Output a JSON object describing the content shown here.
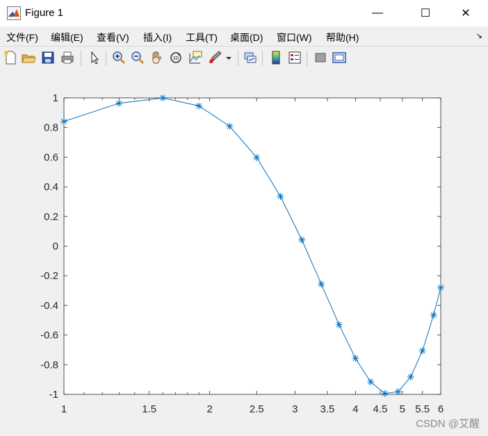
{
  "window": {
    "title": "Figure 1",
    "minimize_symbol": "—",
    "maximize_symbol": "☐",
    "close_symbol": "✕"
  },
  "menu": {
    "items": [
      "文件(F)",
      "编辑(E)",
      "查看(V)",
      "插入(I)",
      "工具(T)",
      "桌面(D)",
      "窗口(W)",
      "帮助(H)"
    ],
    "dock_arrow": "↘"
  },
  "toolbar": {
    "icons": [
      "new-figure-icon",
      "open-file-icon",
      "save-icon",
      "print-icon",
      "select-arrow-icon",
      "zoom-in-icon",
      "zoom-out-icon",
      "pan-hand-icon",
      "rotate-3d-icon",
      "data-cursor-icon",
      "brush-icon",
      "link-plot-icon",
      "colorbar-icon",
      "legend-icon",
      "hide-plot-tools-icon",
      "show-plot-tools-icon"
    ]
  },
  "chart_data": {
    "type": "line",
    "title": "",
    "xlabel": "",
    "ylabel": "",
    "xscale": "log",
    "xlim": [
      1,
      6
    ],
    "ylim": [
      -1,
      1
    ],
    "xticks": [
      "1",
      "1.5",
      "2",
      "2.5",
      "3",
      "3.5",
      "4",
      "4.5",
      "5",
      "5.5",
      "6"
    ],
    "yticks": [
      "1",
      "0.8",
      "0.6",
      "0.4",
      "0.2",
      "0",
      "-0.2",
      "-0.4",
      "-0.6",
      "-0.8",
      "-1"
    ],
    "series": [
      {
        "color": "#0072bd",
        "marker": "*",
        "x": [
          1.0,
          1.3,
          1.6,
          1.9,
          2.2,
          2.5,
          2.8,
          3.1,
          3.4,
          3.7,
          4.0,
          4.3,
          4.6,
          4.9,
          5.2,
          5.5,
          5.8,
          6.0
        ],
        "y": [
          0.841,
          0.964,
          0.9996,
          0.946,
          0.808,
          0.598,
          0.335,
          0.042,
          -0.256,
          -0.53,
          -0.757,
          -0.916,
          -0.994,
          -0.982,
          -0.883,
          -0.706,
          -0.465,
          -0.279
        ]
      }
    ]
  },
  "watermark": "CSDN @艾醒"
}
